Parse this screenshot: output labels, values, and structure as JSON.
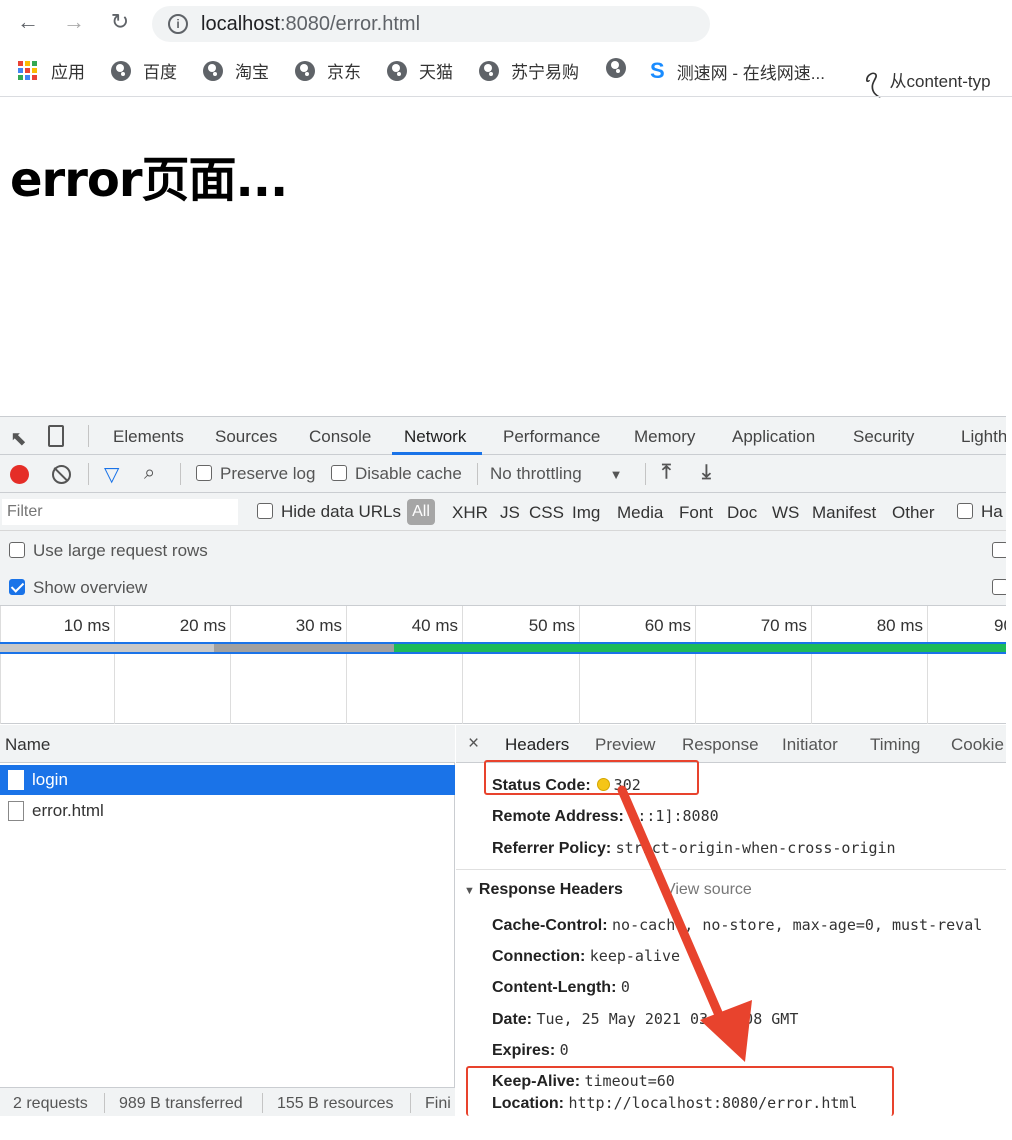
{
  "browser": {
    "url_host": "localhost",
    "url_path": ":8080/error.html",
    "back_icon": "←",
    "forward_icon": "→",
    "reload_icon": "↻",
    "info_icon": "i",
    "bookmarks": {
      "apps": "应用",
      "b1": "百度",
      "b2": "淘宝",
      "b3": "京东",
      "b4": "天猫",
      "b5": "苏宁易购",
      "b6": "测速网 - 在线网速...",
      "b7": "从content-typ"
    }
  },
  "page": {
    "heading": "error页面..."
  },
  "devtools": {
    "tabs": [
      "Elements",
      "Sources",
      "Console",
      "Network",
      "Performance",
      "Memory",
      "Application",
      "Security",
      "Lighth"
    ],
    "active_tab": "Network",
    "toolbar": {
      "preserve_log": "Preserve log",
      "disable_cache": "Disable cache",
      "throttling": "No throttling"
    },
    "filter": {
      "placeholder": "Filter",
      "hide_data_urls": "Hide data URLs",
      "all": "All",
      "types": [
        "XHR",
        "JS",
        "CSS",
        "Img",
        "Media",
        "Font",
        "Doc",
        "WS",
        "Manifest",
        "Other"
      ],
      "trailing": "Ha"
    },
    "options": {
      "large_rows": "Use large request rows",
      "show_overview": "Show overview",
      "show_overview_checked": true
    },
    "timeline_ticks": [
      "10 ms",
      "20 ms",
      "30 ms",
      "40 ms",
      "50 ms",
      "60 ms",
      "70 ms",
      "80 ms",
      "90"
    ],
    "requests_header": "Name",
    "requests": [
      "login",
      "error.html"
    ],
    "selected_request": "login",
    "details_tabs": [
      "Headers",
      "Preview",
      "Response",
      "Initiator",
      "Timing",
      "Cookie"
    ],
    "general": {
      "status_code_label": "Status Code:",
      "status_code": "302",
      "remote_address_label": "Remote Address:",
      "remote_address": "[::1]:8080",
      "referrer_policy_label": "Referrer Policy:",
      "referrer_policy": "strict-origin-when-cross-origin"
    },
    "response_headers": {
      "title": "Response Headers",
      "view_source": "View source",
      "items": [
        {
          "k": "Cache-Control:",
          "v": "no-cache, no-store, max-age=0, must-reval"
        },
        {
          "k": "Connection:",
          "v": "keep-alive"
        },
        {
          "k": "Content-Length:",
          "v": "0"
        },
        {
          "k": "Date:",
          "v": "Tue, 25 May 2021 03:25:08 GMT"
        },
        {
          "k": "Expires:",
          "v": "0"
        },
        {
          "k": "Keep-Alive:",
          "v": "timeout=60"
        },
        {
          "k": "Location:",
          "v": "http://localhost:8080/error.html"
        }
      ]
    },
    "status_bar": {
      "requests": "2 requests",
      "transferred": "989 B transferred",
      "resources": "155 B resources",
      "finish": "Fini"
    }
  },
  "colors": {
    "accent": "#1a73e8",
    "annotation": "#e8432d",
    "status_dot": "#f5c518"
  }
}
